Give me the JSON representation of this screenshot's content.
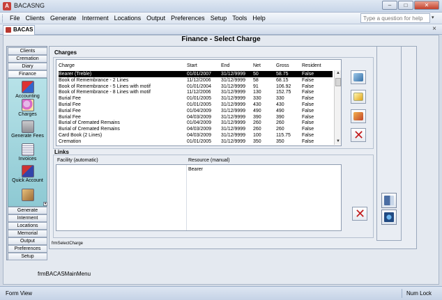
{
  "window": {
    "title": "BACASNG",
    "app_icon_letter": "A",
    "min": "–",
    "max": "□",
    "close": "✕"
  },
  "menu": {
    "items": [
      "File",
      "Clients",
      "Generate",
      "Interment",
      "Locations",
      "Output",
      "Preferences",
      "Setup",
      "Tools",
      "Help"
    ],
    "question_placeholder": "Type a question for help"
  },
  "mdi": {
    "tab_label": "BACAS",
    "close": "×"
  },
  "form": {
    "title": "Finance - Select Charge",
    "form_name": "frmSelectCharge",
    "main_menu_name": "frmBACASMainMenu"
  },
  "nav": {
    "top_buttons": [
      "Clients",
      "Cremation",
      "Diary",
      "Finance"
    ],
    "tiles": [
      {
        "label": "Accounting",
        "icon": "accounting-icon"
      },
      {
        "label": "Charges",
        "icon": "charges-icon"
      },
      {
        "label": "Generate Fees",
        "icon": "generate-fees-icon"
      },
      {
        "label": "Invoices",
        "icon": "invoices-icon"
      },
      {
        "label": "Quick Account",
        "icon": "quick-account-icon"
      },
      {
        "label": "",
        "icon": "extra-icon"
      }
    ],
    "bottom_buttons": [
      "Generate",
      "Interment",
      "Locations",
      "Memorial",
      "Output",
      "Preferences",
      "Setup"
    ],
    "scroll_glyph": "▾"
  },
  "charges": {
    "label": "Charges",
    "columns": [
      "Charge",
      "Start",
      "End",
      "Net",
      "Gross",
      "Resident"
    ],
    "rows": [
      [
        "Bearer (Treble)",
        "01/01/2007",
        "31/12/9999",
        "50",
        "58.75",
        "False"
      ],
      [
        "Book of Remembrance - 2 Lines",
        "11/12/2006",
        "31/12/9999",
        "58",
        "68.15",
        "False"
      ],
      [
        "Book of Remembrance - 5 Lines with motif",
        "01/01/2004",
        "31/12/9999",
        "91",
        "106.92",
        "False"
      ],
      [
        "Book of Remembrance - 8 Lines with motif",
        "11/12/2006",
        "31/12/9999",
        "130",
        "152.75",
        "False"
      ],
      [
        "Burial Fee",
        "01/01/2005",
        "31/12/9999",
        "330",
        "330",
        "False"
      ],
      [
        "Burial Fee",
        "01/01/2005",
        "31/12/9999",
        "430",
        "430",
        "False"
      ],
      [
        "Burial Fee",
        "01/04/2009",
        "31/12/9999",
        "490",
        "490",
        "False"
      ],
      [
        "Burial Fee",
        "04/03/2009",
        "31/12/9999",
        "390",
        "390",
        "False"
      ],
      [
        "Burial of Cremated Remains",
        "01/04/2009",
        "31/12/9999",
        "260",
        "260",
        "False"
      ],
      [
        "Burial of Cremated Remains",
        "04/03/2009",
        "31/12/9999",
        "260",
        "260",
        "False"
      ],
      [
        "Card Book (2 Lines)",
        "04/03/2009",
        "31/12/9999",
        "100",
        "115.75",
        "False"
      ],
      [
        "Cremation",
        "01/01/2005",
        "31/12/9999",
        "350",
        "350",
        "False"
      ]
    ],
    "selected_row": 0,
    "scroll_up": "▲",
    "scroll_down": "▼",
    "delete_glyph": "✕"
  },
  "links": {
    "label": "Links",
    "columns": [
      "Facility (automatic)",
      "Resource (manual)"
    ],
    "resource_value": "Bearer",
    "delete_glyph": "✕"
  },
  "status": {
    "left": "Form View",
    "right": "Num Lock"
  }
}
